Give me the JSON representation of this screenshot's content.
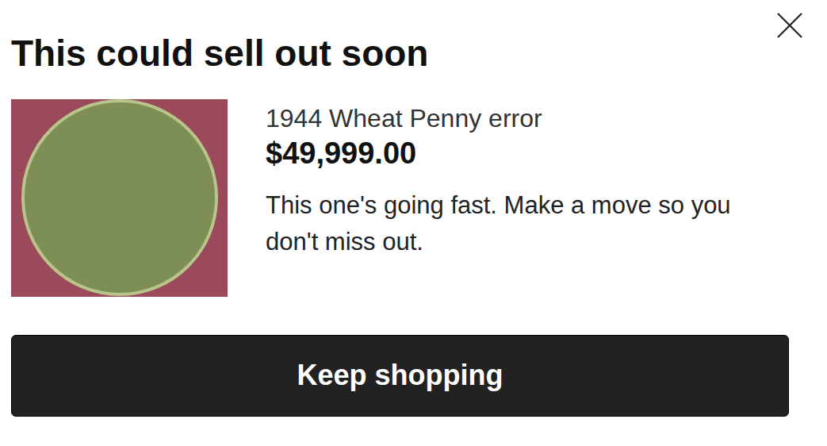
{
  "dialog": {
    "title": "This could sell out soon"
  },
  "listing": {
    "name": "1944 Wheat Penny error",
    "price": "$49,999.00",
    "message": "This one's going fast. Make a move so you don't miss out."
  },
  "button": {
    "label": "Keep shopping"
  }
}
